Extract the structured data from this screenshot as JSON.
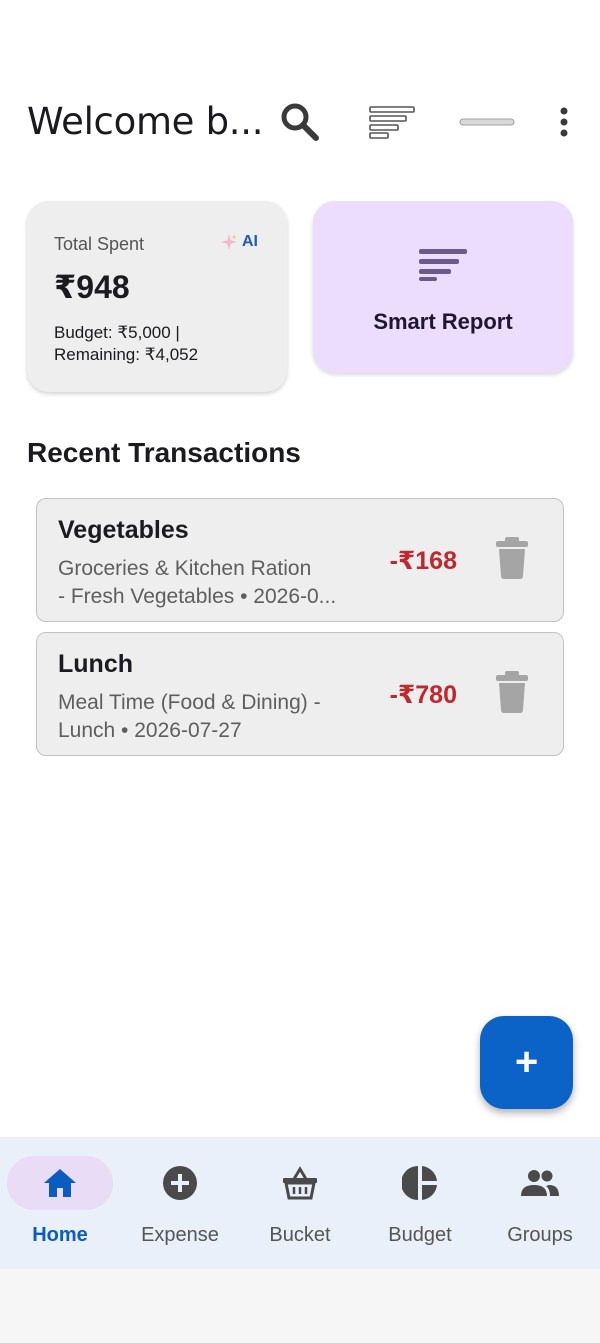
{
  "header": {
    "title": "Welcome b...",
    "icons": [
      "search-icon",
      "sort-icon",
      "minimize-icon",
      "more-vert-icon"
    ]
  },
  "summary": {
    "label": "Total Spent",
    "ai_badge": "AI",
    "amount": "₹948",
    "budget_text": "Budget: ₹5,000  |",
    "remaining_text": "Remaining: ₹4,052"
  },
  "report": {
    "label": "Smart Report"
  },
  "recent": {
    "title": "Recent Transactions",
    "items": [
      {
        "name": "Vegetables",
        "desc_line1": "Groceries & Kitchen Ration",
        "desc_line2": "- Fresh Vegetables  •  2026-0...",
        "amount": "-₹168"
      },
      {
        "name": "Lunch",
        "desc_line1": "Meal Time (Food & Dining) -",
        "desc_line2": "Lunch  •  2026-07-27",
        "amount": "-₹780"
      }
    ]
  },
  "fab": {
    "label": "+"
  },
  "nav": {
    "items": [
      {
        "label": "Home",
        "icon": "home-icon",
        "active": true
      },
      {
        "label": "Expense",
        "icon": "add-circle-icon",
        "active": false
      },
      {
        "label": "Bucket",
        "icon": "basket-icon",
        "active": false
      },
      {
        "label": "Budget",
        "icon": "pie-chart-icon",
        "active": false
      },
      {
        "label": "Groups",
        "icon": "groups-icon",
        "active": false
      }
    ]
  },
  "colors": {
    "primary": "#0b63c8",
    "expense_red": "#c0282d",
    "report_bg": "#ecdcfd",
    "nav_bg": "#e9f0fa"
  }
}
